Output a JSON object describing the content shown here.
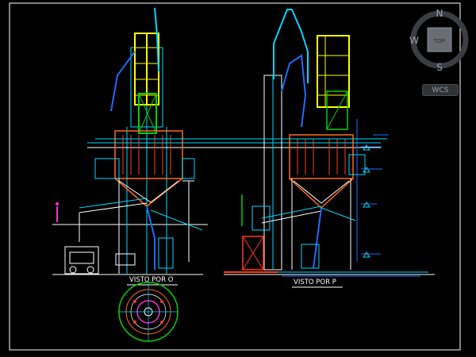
{
  "drawing": {
    "view_o_label": "VISTO POR O",
    "view_p_label": "VISTO POR P"
  },
  "viewcube": {
    "north": "N",
    "south": "S",
    "west": "W",
    "top_face": "TOP",
    "wcs_label": "WCS"
  },
  "colors": {
    "background": "#000000",
    "frame": "#ffffff",
    "structure_cyan": "#00d8ff",
    "railing_yellow": "#ffff00",
    "equipment_red": "#ff3b1a",
    "hopper_orange": "#ff6a1a",
    "frame_green": "#00d000",
    "pipe_blue": "#1e6bff",
    "magenta": "#ff2bd4"
  }
}
